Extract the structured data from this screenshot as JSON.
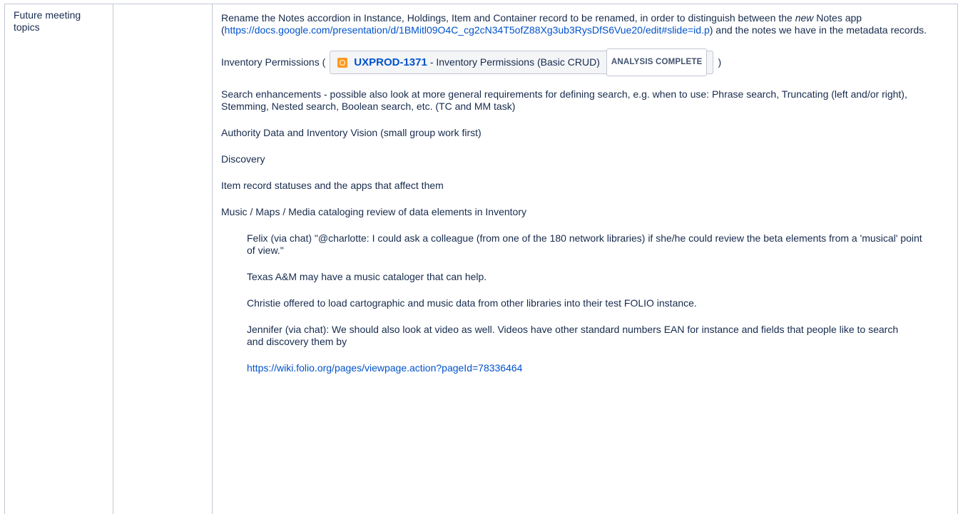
{
  "row_label": "Future meeting topics",
  "notes_rename": {
    "text_before": "Rename the Notes accordion in Instance, Holdings, Item and Container record to be renamed, in order to distinguish between the ",
    "emphasis": "new",
    "text_mid": " Notes app (",
    "link": "https://docs.google.com/presentation/d/1BMitl09O4C_cg2cN34T5ofZ88Xg3ub3RysDfS6Vue20/edit#slide=id.p",
    "text_after": ") and the notes we have in the metadata records."
  },
  "inventory_permissions": {
    "prefix": "Inventory Permissions (",
    "jira_key": "UXPROD-1371",
    "jira_summary": " - Inventory Permissions (Basic CRUD)",
    "jira_status": "ANALYSIS COMPLETE",
    "suffix": ")",
    "status_color": "#42526e",
    "icon": "jira-improvement-icon"
  },
  "paragraphs": [
    "Search enhancements - possible also look at more general requirements for defining search, e.g. when to use: Phrase search, Truncating (left and/or right), Stemming, Nested search, Boolean search, etc. (TC and MM task)",
    "Authority Data and Inventory Vision (small group work first)",
    "Discovery",
    "Item record statuses and the apps that affect them",
    "Music / Maps / Media cataloging review of data elements in Inventory"
  ],
  "indented": [
    "Felix (via chat) \"@charlotte: I could ask a colleague (from one of the 180 network libraries) if she/he could review the beta elements from a 'musical' point of view.\"",
    "Texas A&M may have a music cataloger that can help.",
    "Christie offered to load cartographic and music data from other libraries into their test FOLIO instance.",
    "Jennifer (via chat): We should also look at video as well. Videos have other standard numbers EAN for instance and fields that people like to search and discovery them by"
  ],
  "wiki_link": "https://wiki.folio.org/pages/viewpage.action?pageId=78336464",
  "colors": {
    "link": "#0052cc",
    "text": "#172b4d",
    "border": "#c1c7d0",
    "jira_icon": "#ff991f"
  }
}
